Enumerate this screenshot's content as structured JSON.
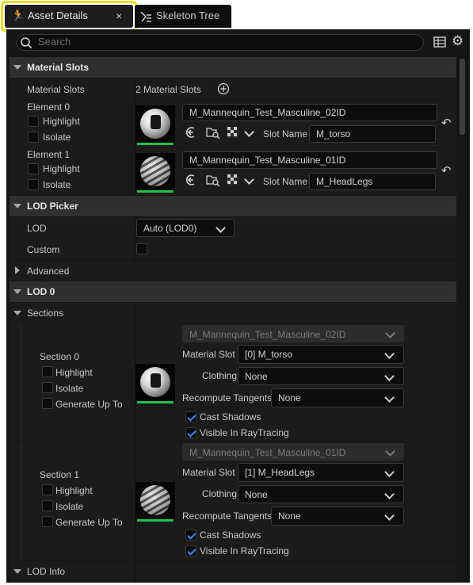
{
  "tabs": [
    {
      "label": "Asset Details",
      "icon": "character-icon",
      "close": "×"
    },
    {
      "label": "Skeleton Tree",
      "icon": "bone-tree-icon"
    }
  ],
  "search": {
    "placeholder": "Search"
  },
  "material_slots": {
    "header": "Material Slots",
    "row_label": "Material Slots",
    "count_text": "2 Material Slots",
    "elements": [
      {
        "label": "Element 0",
        "highlight": "Highlight",
        "isolate": "Isolate",
        "material": "M_Mannequin_Test_Masculine_02ID",
        "slot_name_label": "Slot Name",
        "slot_name": "M_torso"
      },
      {
        "label": "Element 1",
        "highlight": "Highlight",
        "isolate": "Isolate",
        "material": "M_Mannequin_Test_Masculine_01ID",
        "slot_name_label": "Slot Name",
        "slot_name": "M_HeadLegs"
      }
    ]
  },
  "lod_picker": {
    "header": "LOD Picker",
    "lod_label": "LOD",
    "lod_value": "Auto (LOD0)",
    "custom_label": "Custom",
    "advanced_label": "Advanced"
  },
  "lod0": {
    "header": "LOD 0",
    "sections_label": "Sections",
    "sections": [
      {
        "label": "Section 0",
        "highlight": "Highlight",
        "isolate": "Isolate",
        "generate": "Generate Up To",
        "material": "M_Mannequin_Test_Masculine_02ID",
        "material_slot_label": "Material Slot",
        "material_slot": "[0] M_torso",
        "clothing_label": "Clothing",
        "clothing": "None",
        "recompute_label": "Recompute Tangents",
        "recompute": "None",
        "cast_shadows": "Cast Shadows",
        "visible_rt": "Visible In RayTracing"
      },
      {
        "label": "Section 1",
        "highlight": "Highlight",
        "isolate": "Isolate",
        "generate": "Generate Up To",
        "material": "M_Mannequin_Test_Masculine_01ID",
        "material_slot_label": "Material Slot",
        "material_slot": "[1] M_HeadLegs",
        "clothing_label": "Clothing",
        "clothing": "None",
        "recompute_label": "Recompute Tangents",
        "recompute": "None",
        "cast_shadows": "Cast Shadows",
        "visible_rt": "Visible In RayTracing"
      }
    ]
  },
  "lod_info": {
    "label": "LOD Info"
  },
  "colors": {
    "highlight_border": "#f3dc0a",
    "accent_blue": "#2f8bff",
    "thumb_ok": "#1fc44b"
  }
}
